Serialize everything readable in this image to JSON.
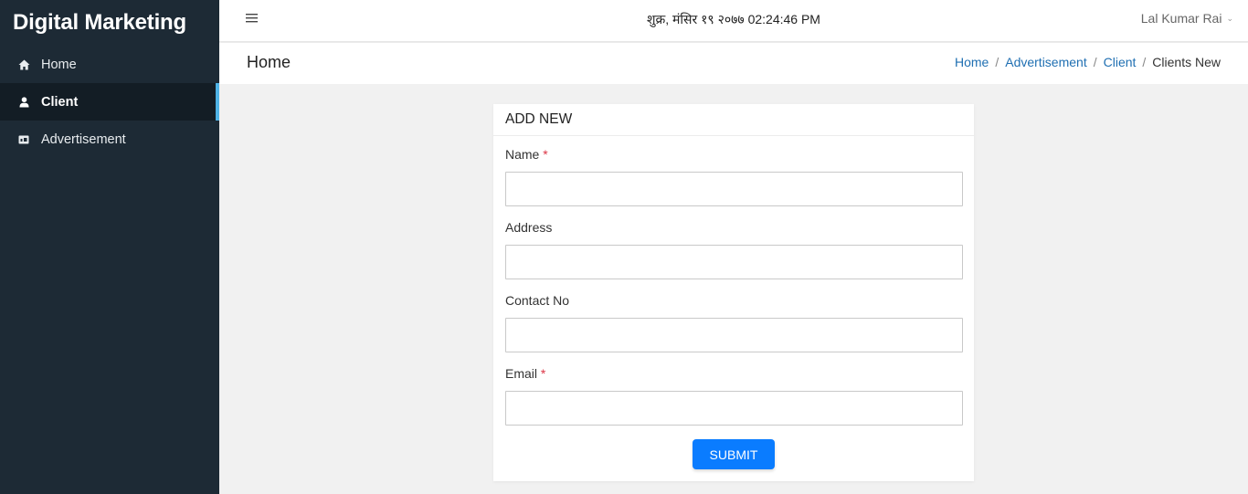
{
  "sidebar": {
    "brand": "Digital Marketing",
    "items": [
      {
        "label": "Home",
        "icon": "home-icon"
      },
      {
        "label": "Client",
        "icon": "user-icon",
        "active": true
      },
      {
        "label": "Advertisement",
        "icon": "ad-icon"
      }
    ]
  },
  "topbar": {
    "datetime": "शुक्र, मंसिर १९ २०७७ 02:24:46 PM",
    "user": "Lal Kumar Rai",
    "menu_icon": "hamburger-icon"
  },
  "subheader": {
    "title": "Home",
    "breadcrumb": [
      "Home",
      "Advertisement",
      "Client",
      "Clients New"
    ],
    "separator": "/"
  },
  "form": {
    "title": "ADD NEW",
    "fields": [
      {
        "label": "Name",
        "required": true,
        "value": ""
      },
      {
        "label": "Address",
        "required": false,
        "value": ""
      },
      {
        "label": "Contact No",
        "required": false,
        "value": ""
      },
      {
        "label": "Email",
        "required": true,
        "value": ""
      }
    ],
    "required_mark": "*",
    "submit_label": "SUBMIT"
  },
  "colors": {
    "sidebar_bg": "#1d2a35",
    "active_indicator": "#4fb3e6",
    "link": "#1f6fb2",
    "primary_button": "#0a7cff",
    "required": "#dc3545"
  }
}
